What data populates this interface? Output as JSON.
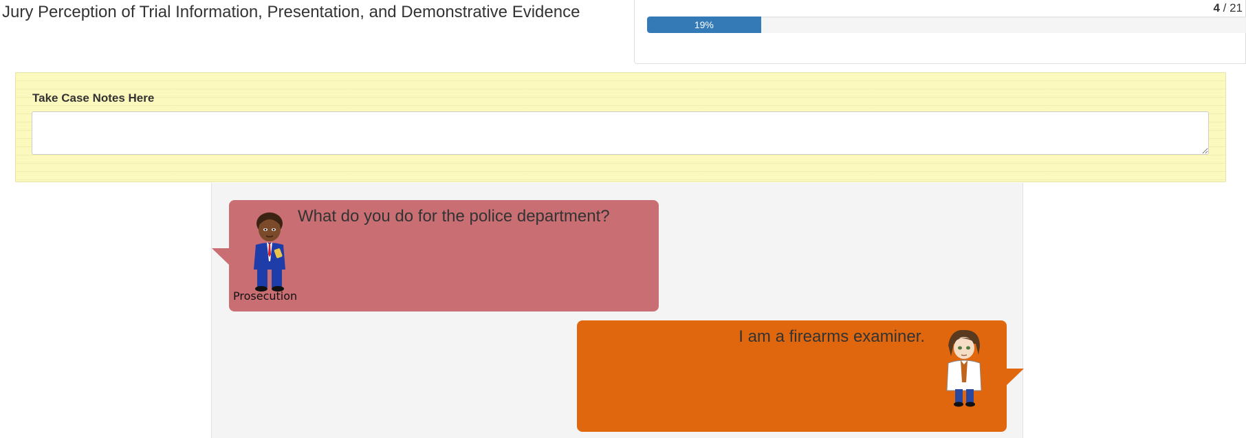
{
  "survey": {
    "title": "Jury Perception of Trial Information, Presentation, and Demonstrative Evidence"
  },
  "progress": {
    "current_page": "4",
    "separator": " / ",
    "total_pages": "21",
    "percent_label": "19%",
    "percent_value": 19,
    "bar_color": "#337ab7"
  },
  "notes": {
    "label": "Take Case Notes Here",
    "value": "",
    "placeholder": ""
  },
  "dialogue": {
    "messages": [
      {
        "speaker": "Prosecution",
        "text": "What do you do for the police department?",
        "avatar_icon": "prosecutor-avatar-icon",
        "bubble_color": "#c96e72"
      },
      {
        "speaker": "",
        "text": "I am a firearms examiner.",
        "avatar_icon": "firearms-examiner-avatar-icon",
        "bubble_color": "#e0670d"
      }
    ]
  }
}
